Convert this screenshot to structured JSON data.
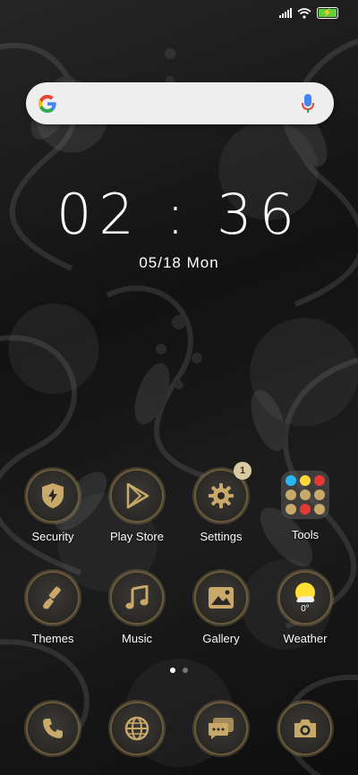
{
  "status_bar": {
    "signal_icon": "signal-icon",
    "wifi_icon": "wifi-icon",
    "battery_icon": "battery-charging-icon",
    "battery_color": "#5ecf3a"
  },
  "search": {
    "logo": "G",
    "logo_icon": "google-logo-icon",
    "mic_icon": "microphone-icon"
  },
  "clock": {
    "time": "02 : 36",
    "date": "05/18  Mon"
  },
  "apps_row1": [
    {
      "label": "Security",
      "icon": "shield-bolt-icon"
    },
    {
      "label": "Play Store",
      "icon": "play-store-icon"
    },
    {
      "label": "Settings",
      "icon": "gear-icon",
      "badge": "1"
    },
    {
      "label": "Tools",
      "icon": "folder-icon"
    }
  ],
  "apps_row2": [
    {
      "label": "Themes",
      "icon": "paintbrush-icon"
    },
    {
      "label": "Music",
      "icon": "music-note-icon"
    },
    {
      "label": "Gallery",
      "icon": "image-icon"
    },
    {
      "label": "Weather",
      "icon": "weather-sun-icon",
      "temperature": "0°"
    }
  ],
  "dock": [
    {
      "icon": "phone-icon"
    },
    {
      "icon": "globe-icon"
    },
    {
      "icon": "chat-icon"
    },
    {
      "icon": "camera-icon"
    }
  ],
  "page_indicator": {
    "pages": 2,
    "active": 1
  },
  "colors": {
    "accent_gold": "#c9a96a",
    "icon_bg": "#2f2d29",
    "badge_bg": "#d9c9a0"
  }
}
